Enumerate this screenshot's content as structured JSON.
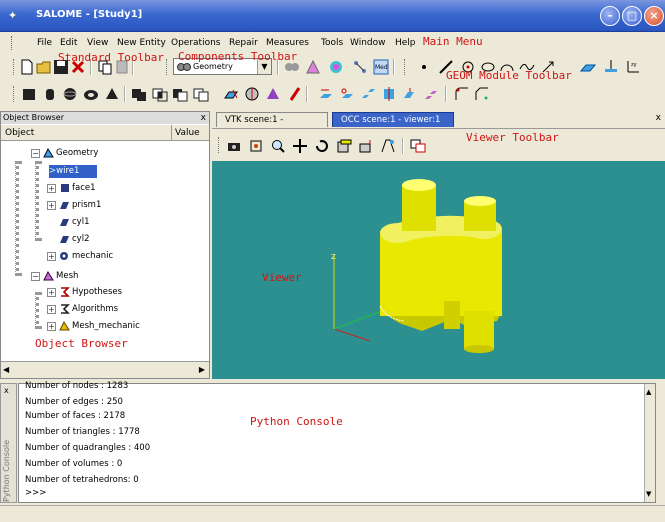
{
  "window": {
    "title": "SALOME - [Study1]",
    "minimize_glyph": "–",
    "maximize_glyph": "□",
    "close_glyph": "×"
  },
  "menu": {
    "items": [
      "File",
      "Edit",
      "View",
      "New Entity",
      "Operations",
      "Repair",
      "Measures",
      "Tools",
      "Window",
      "Help"
    ]
  },
  "annotations": {
    "main_menu": "Main Menu",
    "standard_toolbar": "Standard Toolbar",
    "components_toolbar": "Components Toolbar",
    "geom_toolbar": "GEOM Module Toolbar",
    "viewer_toolbar": "Viewer Toolbar",
    "object_browser": "Object Browser",
    "viewer": "Viewer",
    "python_console": "Python Console"
  },
  "components": {
    "selected": "Geometry"
  },
  "object_browser": {
    "title": "Object Browser",
    "close_glyph": "x",
    "col_object": "Object",
    "col_value": "Value",
    "nodes": {
      "geometry": "Geometry",
      "wire1": "wire1",
      "face1": "face1",
      "prism1": "prism1",
      "cyl1": "cyl1",
      "cyl2": "cyl2",
      "mechanic": "mechanic",
      "mesh": "Mesh",
      "hypotheses": "Hypotheses",
      "algorithms": "Algorithms",
      "mesh_mechanic": "Mesh_mechanic"
    }
  },
  "viewer": {
    "tabs": [
      "VTK scene:1 - viewer:1",
      "OCC scene:1 - viewer:1"
    ],
    "active_tab": 1,
    "close_glyph": "x",
    "axis_z": "Z"
  },
  "console": {
    "side_label": "Python Console",
    "close_glyph": "x",
    "lines": [
      "Number of nodes     : 1283",
      "Number of edges     : 250",
      "Number of faces     : 2178",
      "Number of triangles  : 1778",
      "Number of quadrangles : 400",
      "Number of volumes    : 0",
      "Number of tetrahedrons: 0",
      "",
      ">>>"
    ]
  },
  "colors": {
    "title_bar": "#2a55c0",
    "viewer_bg": "#2c9090",
    "shape": "#e8e800",
    "annotation": "#d01414",
    "selection": "#3060c8"
  }
}
